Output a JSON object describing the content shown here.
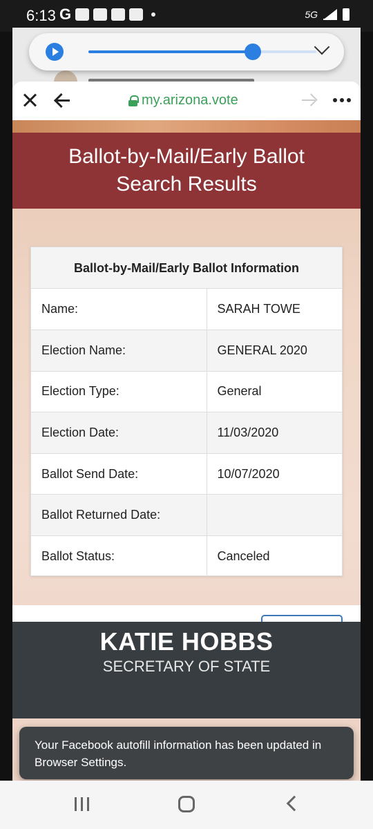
{
  "status_bar": {
    "time": "6:13",
    "network": "5G"
  },
  "media_player": {
    "progress": 0.72
  },
  "browser": {
    "url": "my.arizona.vote"
  },
  "page": {
    "title_line1": "Ballot-by-Mail/Early Ballot",
    "title_line2": "Search Results",
    "card_title": "Ballot-by-Mail/Early Ballot Information",
    "rows": [
      {
        "label": "Name:",
        "value": "SARAH TOWE"
      },
      {
        "label": "Election Name:",
        "value": "GENERAL 2020"
      },
      {
        "label": "Election Type:",
        "value": "General"
      },
      {
        "label": "Election Date:",
        "value": "11/03/2020"
      },
      {
        "label": "Ballot Send Date:",
        "value": "10/07/2020"
      },
      {
        "label": "Ballot Returned Date:",
        "value": ""
      },
      {
        "label": "Ballot Status:",
        "value": "Canceled"
      }
    ],
    "footer_name": "KATIE HOBBS",
    "footer_subtitle": "SECRETARY OF STATE"
  },
  "toast": {
    "message": "Your Facebook autofill information has been updated in Browser Settings."
  },
  "colors": {
    "banner": "#8e3437",
    "link_green": "#3aa05a",
    "footer": "#373d40",
    "accent_blue": "#2b7fe0"
  }
}
